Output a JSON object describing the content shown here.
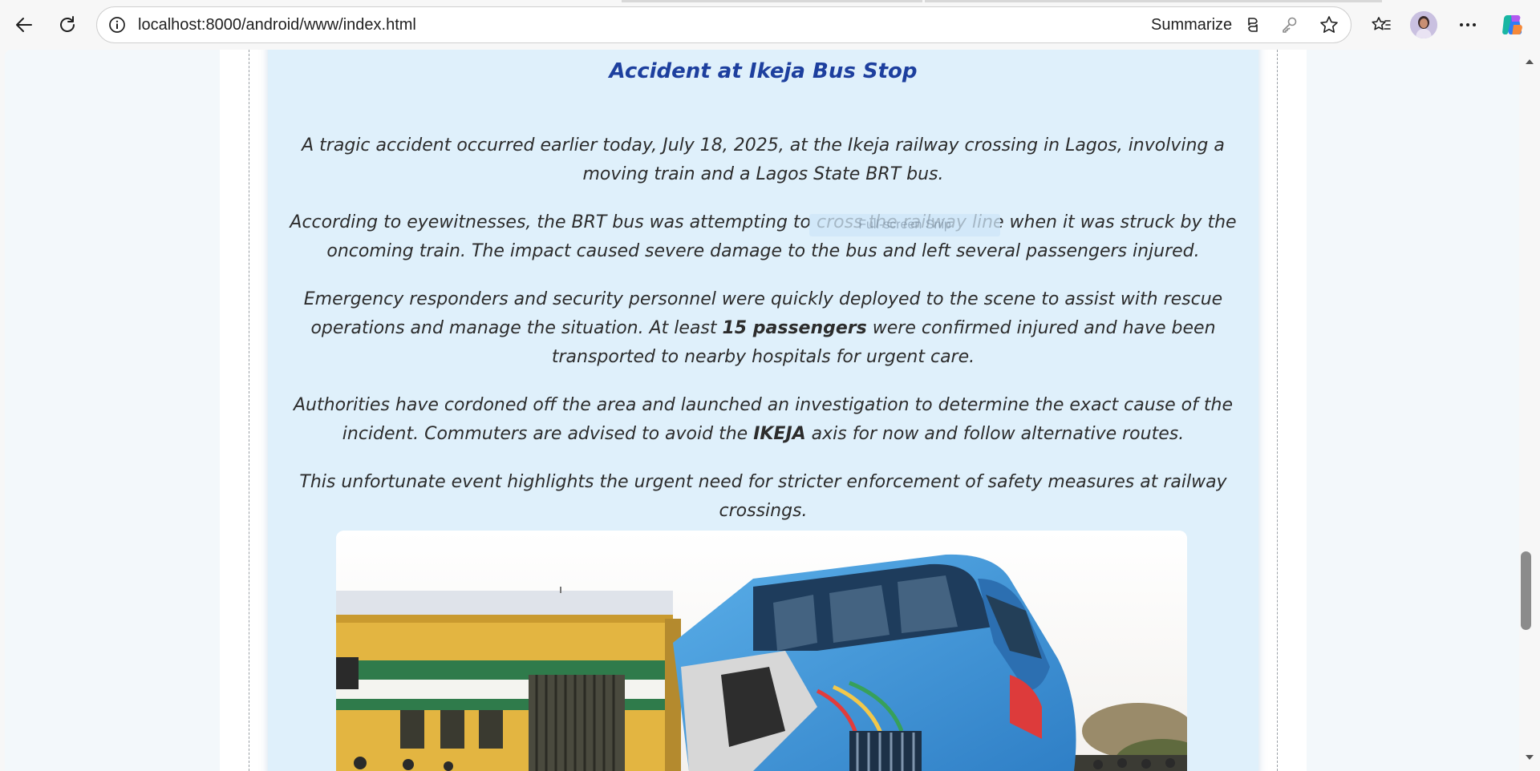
{
  "browser": {
    "url": "localhost:8000/android/www/index.html",
    "summarize_label": "Summarize",
    "icons": [
      "back-icon",
      "refresh-icon",
      "info-icon",
      "copilot-summarize-icon",
      "key-icon",
      "star-icon",
      "favorites-icon",
      "more-icon",
      "copilot-icon"
    ]
  },
  "article": {
    "title": "Accident at Ikeja Bus Stop",
    "p1": "A tragic accident occurred earlier today, July 18, 2025, at the Ikeja railway crossing in Lagos, involving a moving train and a Lagos State BRT bus.",
    "p2": "According to eyewitnesses, the BRT bus was attempting to cross the railway line when it was struck by the oncoming train. The impact caused severe damage to the bus and left several passengers injured.",
    "p3_a": "Emergency responders and security personnel were quickly deployed to the scene to assist with rescue operations and manage the situation. At least ",
    "p3_bold": "15 passengers",
    "p3_b": " were confirmed injured and have been transported to nearby hospitals for urgent care.",
    "p4_a": "Authorities have cordoned off the area and launched an investigation to determine the exact cause of the incident. Commuters are advised to avoid the ",
    "p4_bold": "IKEJA",
    "p4_b": " axis for now and follow alternative routes.",
    "p5": "This unfortunate event highlights the urgent need for stricter enforcement of safety measures at railway crossings."
  },
  "overlay": {
    "snip_label": "Full-screen Snip"
  },
  "colors": {
    "card_bg": "#dff0fb",
    "title": "#1d3f9e",
    "bus_blue": "#3d8fd6",
    "train_yellow": "#e4b53d",
    "train_green": "#2c7a4a"
  }
}
